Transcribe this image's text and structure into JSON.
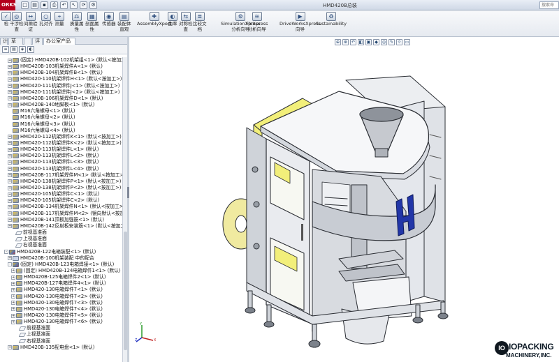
{
  "window": {
    "logo": "ORKS",
    "document_title": "HMD420B总装",
    "search_placeholder": "搜索命"
  },
  "ribbon": [
    {
      "id": "check",
      "label": "检",
      "icon": "✓"
    },
    {
      "id": "interference",
      "label": "干涉检\n查",
      "icon": "◎"
    },
    {
      "id": "clearance",
      "label": "间隙验\n证",
      "icon": "↔"
    },
    {
      "id": "hole-align",
      "label": "孔对齐",
      "icon": "○"
    },
    {
      "id": "measure",
      "label": "测量",
      "icon": "⌖"
    },
    {
      "id": "mass-props",
      "label": "质量属\n性",
      "icon": "⚖"
    },
    {
      "id": "section-props",
      "label": "剖面属\n性",
      "icon": "▦"
    },
    {
      "id": "sensor",
      "label": "传感器",
      "icon": "◉"
    },
    {
      "id": "assembly-visual",
      "label": "装配体\n直观",
      "icon": "▤"
    },
    {
      "id": "assemblyxpert",
      "label": "AssemblyXpert",
      "icon": "✚"
    },
    {
      "id": "curvature",
      "label": "曲率",
      "icon": "◐"
    },
    {
      "id": "symmetry-check",
      "label": "对称检\n查",
      "icon": "⇆"
    },
    {
      "id": "compare-docs",
      "label": "比较文\n档",
      "icon": "≣"
    },
    {
      "id": "simxpress",
      "label": "SimulationXpress\n分析向导",
      "icon": "⚙"
    },
    {
      "id": "floxpress",
      "label": "FloXpress\n分析向导",
      "icon": "≋"
    },
    {
      "id": "driveworksxpress",
      "label": "DriveWorksXpress\n向导",
      "icon": "▶"
    },
    {
      "id": "sustainability",
      "label": "Sustainability",
      "icon": "♻"
    }
  ],
  "tabs": [
    {
      "id": "tab-x",
      "label": "计"
    },
    {
      "id": "tab-sketch",
      "label": "草图"
    },
    {
      "id": "tab-blank",
      "label": ""
    },
    {
      "id": "tab-evaluate",
      "label": "评估"
    },
    {
      "id": "tab-office",
      "label": "办公室产品"
    }
  ],
  "tree": [
    {
      "lvl": 0,
      "icon": "part",
      "exp": "+",
      "text": "(固定) HMD420B-102机架组<1> (默认<按加工>)"
    },
    {
      "lvl": 0,
      "icon": "part",
      "exp": "+",
      "text": "HMD420B-103机架焊件A<1> (默认)"
    },
    {
      "lvl": 0,
      "icon": "part",
      "exp": "+",
      "text": "HMD420B-104机架焊件B<1> (默认)"
    },
    {
      "lvl": 0,
      "icon": "part",
      "exp": "+",
      "text": "HMD420-110机架焊件H<1> (默认<按加工>)"
    },
    {
      "lvl": 0,
      "icon": "part",
      "exp": "+",
      "text": "HMD420-111机架焊件J<1> (默认<按加工>)"
    },
    {
      "lvl": 0,
      "icon": "part",
      "exp": "+",
      "text": "HMD420-111机架焊件J<2> (默认<按加工>)"
    },
    {
      "lvl": 0,
      "icon": "part",
      "exp": "+",
      "text": "HMD420B-106机架焊件D<1> (默认)"
    },
    {
      "lvl": 0,
      "icon": "part",
      "exp": "+",
      "text": "HMD420B-140地脚板<1> (默认)"
    },
    {
      "lvl": 0,
      "icon": "part",
      "exp": "",
      "text": "M16六角螺母<1> (默认)"
    },
    {
      "lvl": 0,
      "icon": "part",
      "exp": "",
      "text": "M16六角螺母<2> (默认)"
    },
    {
      "lvl": 0,
      "icon": "part",
      "exp": "",
      "text": "M16六角螺母<3> (默认)"
    },
    {
      "lvl": 0,
      "icon": "part",
      "exp": "",
      "text": "M16六角螺母<4> (默认)"
    },
    {
      "lvl": 0,
      "icon": "part",
      "exp": "+",
      "text": "HMD420-112机架焊件K<1> (默认<按加工>)"
    },
    {
      "lvl": 0,
      "icon": "part",
      "exp": "+",
      "text": "HMD420-112机架焊件K<2> (默认<按加工>)"
    },
    {
      "lvl": 0,
      "icon": "part",
      "exp": "+",
      "text": "HMD420-113机架焊件L<1> (默认)"
    },
    {
      "lvl": 0,
      "icon": "part",
      "exp": "+",
      "text": "HMD420-113机架焊件L<2> (默认)"
    },
    {
      "lvl": 0,
      "icon": "part",
      "exp": "+",
      "text": "HMD420-113机架焊件L<3> (默认)"
    },
    {
      "lvl": 0,
      "icon": "part",
      "exp": "+",
      "text": "HMD420-113机架焊件L<4> (默认)"
    },
    {
      "lvl": 0,
      "icon": "part",
      "exp": "+",
      "text": "HMD420B-117机架焊件M<1> (默认<按加工>)"
    },
    {
      "lvl": 0,
      "icon": "part",
      "exp": "+",
      "text": "HMD420-138机架焊件P<1> (默认<按加工>)"
    },
    {
      "lvl": 0,
      "icon": "part",
      "exp": "+",
      "text": "HMD420-138机架焊件P<2> (默认<按加工>)"
    },
    {
      "lvl": 0,
      "icon": "part",
      "exp": "+",
      "text": "HMD420-105机架焊件C<1> (默认)"
    },
    {
      "lvl": 0,
      "icon": "part",
      "exp": "+",
      "text": "HMD420-105机架焊件C<2> (默认)"
    },
    {
      "lvl": 0,
      "icon": "part",
      "exp": "+",
      "text": "HMD420B-134机架焊件N<1> (默认<按加工>)"
    },
    {
      "lvl": 0,
      "icon": "part",
      "exp": "+",
      "text": "HMD420B-117机架焊件M<2> (镜向默认<按加工>)"
    },
    {
      "lvl": 0,
      "icon": "part",
      "exp": "+",
      "text": "HMD420B-141顶板加强筋<1> (默认)"
    },
    {
      "lvl": 0,
      "icon": "part",
      "exp": "+",
      "text": "HMD420B-142反射板安装筋<1> (默认<按加工>)"
    },
    {
      "lvl": 1,
      "icon": "plane",
      "exp": "",
      "text": "前视基准面"
    },
    {
      "lvl": 1,
      "icon": "plane",
      "exp": "",
      "text": "上视基准面"
    },
    {
      "lvl": 1,
      "icon": "plane",
      "exp": "",
      "text": "右视基准面"
    },
    {
      "lvl": -1,
      "icon": "asm",
      "exp": "-",
      "text": "HMD420B-122电箱装配<1> (默认)"
    },
    {
      "lvl": 0,
      "icon": "mate",
      "exp": "+",
      "text": "HMD420B-100机架装配 中的配合"
    },
    {
      "lvl": 0,
      "icon": "asm",
      "exp": "-",
      "text": "(固定) HMD420B-123电箱焊接<1> (默认)"
    },
    {
      "lvl": 1,
      "icon": "part",
      "exp": "+",
      "text": "(固定) HMD420B-124电箱焊件1<1> (默认)"
    },
    {
      "lvl": 1,
      "icon": "part",
      "exp": "+",
      "text": "HMD420B-125电箱焊件2<1> (默认)"
    },
    {
      "lvl": 1,
      "icon": "part",
      "exp": "+",
      "text": "HMD420B-127电箱焊件4<1> (默认)"
    },
    {
      "lvl": 1,
      "icon": "part",
      "exp": "+",
      "text": "HMD420-130电箱焊件7<1> (默认)"
    },
    {
      "lvl": 1,
      "icon": "part",
      "exp": "+",
      "text": "HMD420-130电箱焊件7<2> (默认)"
    },
    {
      "lvl": 1,
      "icon": "part",
      "exp": "+",
      "text": "HMD420-130电箱焊件7<3> (默认)"
    },
    {
      "lvl": 1,
      "icon": "part",
      "exp": "+",
      "text": "HMD420-130电箱焊件7<4> (默认)"
    },
    {
      "lvl": 1,
      "icon": "part",
      "exp": "+",
      "text": "HMD420-130电箱焊件7<5> (默认)"
    },
    {
      "lvl": 1,
      "icon": "part",
      "exp": "+",
      "text": "HMD420-130电箱焊件7<6> (默认)"
    },
    {
      "lvl": 2,
      "icon": "plane",
      "exp": "",
      "text": "前视基准面"
    },
    {
      "lvl": 2,
      "icon": "plane",
      "exp": "",
      "text": "上视基准面"
    },
    {
      "lvl": 2,
      "icon": "plane",
      "exp": "",
      "text": "右视基准面"
    },
    {
      "lvl": 0,
      "icon": "part",
      "exp": "+",
      "text": "HMD420B-135配电盘<1> (默认)"
    }
  ],
  "hud": [
    {
      "id": "zoom-fit",
      "icon": "⊕"
    },
    {
      "id": "zoom-area",
      "icon": "⊗"
    },
    {
      "id": "previous-view",
      "icon": "↶"
    },
    {
      "id": "section-view",
      "icon": "◧"
    },
    {
      "id": "view-orientation",
      "icon": "▣"
    },
    {
      "id": "display-style",
      "icon": "◆"
    },
    {
      "id": "hide-show",
      "icon": "◎"
    },
    {
      "id": "edit-appearance",
      "icon": "✎"
    },
    {
      "id": "apply-scene",
      "icon": "☼"
    },
    {
      "id": "view-settings",
      "icon": "▭"
    }
  ],
  "watermark": {
    "mark": "IO",
    "name": "IOPACKING",
    "sub": "MACHINERY,INC."
  },
  "colors": {
    "body": "#e9ebef",
    "edge": "#2a2d33",
    "yellow": "#f2ef7a",
    "blue": "#2236a8",
    "frame": "#cfd3d9"
  }
}
